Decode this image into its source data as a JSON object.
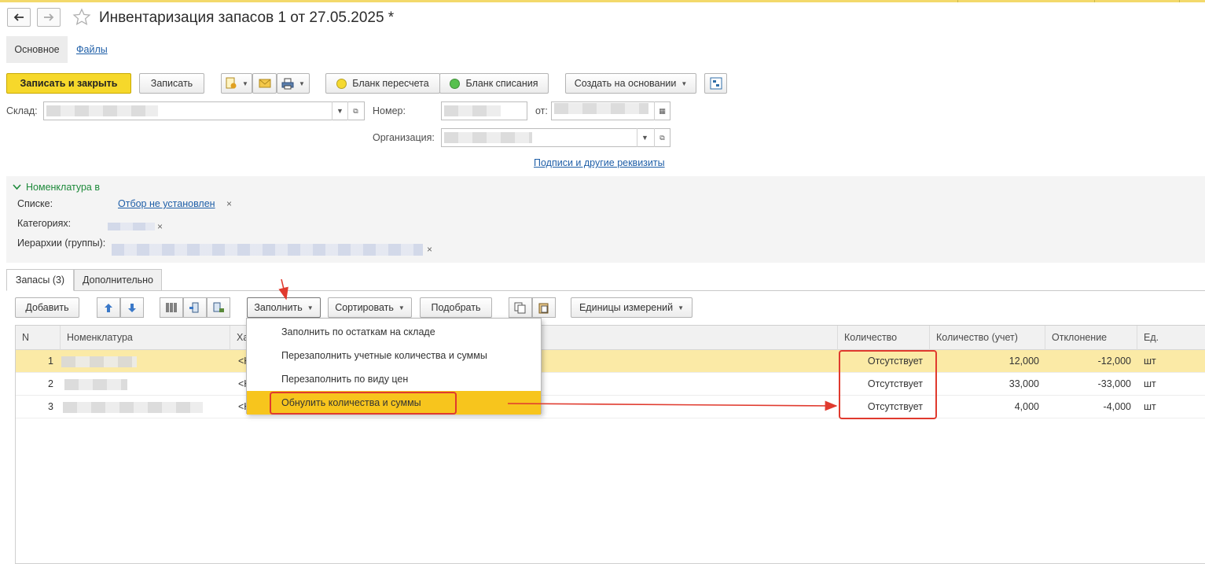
{
  "window": {
    "title": "Инвентаризация запасов 1 от 27.05.2025 *"
  },
  "top_tabs": {
    "main": "Основное",
    "files": "Файлы"
  },
  "toolbar": {
    "save_close": "Записать и закрыть",
    "save": "Записать",
    "blank_recount": "Бланк пересчета",
    "blank_writeoff": "Бланк списания",
    "create_based": "Создать на основании"
  },
  "form": {
    "warehouse_label": "Склад:",
    "number_label": "Номер:",
    "from_label": "от:",
    "org_label": "Организация:",
    "signatures_link": "Подписи и другие реквизиты"
  },
  "filter": {
    "header": "Номенклатура в",
    "lists_label": "Списке:",
    "lists_value": "Отбор не установлен",
    "categories_label": "Категориях:",
    "hierarchy_label": "Иерархии (группы):",
    "clear": "×"
  },
  "tabs": {
    "stock": "Запасы (3)",
    "extra": "Дополнительно"
  },
  "table_toolbar": {
    "add": "Добавить",
    "fill": "Заполнить",
    "sort": "Сортировать",
    "pick": "Подобрать",
    "units": "Единицы измерений"
  },
  "fill_menu": {
    "items": [
      "Заполнить по остаткам на складе",
      "Перезаполнить учетные количества и суммы",
      "Перезаполнить по виду цен",
      "Обнулить количества и суммы"
    ]
  },
  "table": {
    "columns": {
      "n": "N",
      "item": "Номенклатура",
      "char": "Ха",
      "qty": "Количество",
      "qty_acc": "Количество (учет)",
      "dev": "Отклонение",
      "unit": "Ед."
    },
    "rows": [
      {
        "n": "1",
        "char": "<Н",
        "qty": "Отсутствует",
        "qty_acc": "12,000",
        "dev": "-12,000",
        "unit": "шт"
      },
      {
        "n": "2",
        "char": "<Н",
        "qty": "Отсутствует",
        "qty_acc": "33,000",
        "dev": "-33,000",
        "unit": "шт"
      },
      {
        "n": "3",
        "char": "<Н",
        "qty": "Отсутствует",
        "qty_acc": "4,000",
        "dev": "-4,000",
        "unit": "шт"
      }
    ]
  },
  "colors": {
    "accent_yellow": "#f6d82b",
    "menu_highlight": "#f7c51d",
    "selected_row": "#fbeaa6",
    "annotation_red": "#e03a2e",
    "link_blue": "#1f5fa8"
  }
}
